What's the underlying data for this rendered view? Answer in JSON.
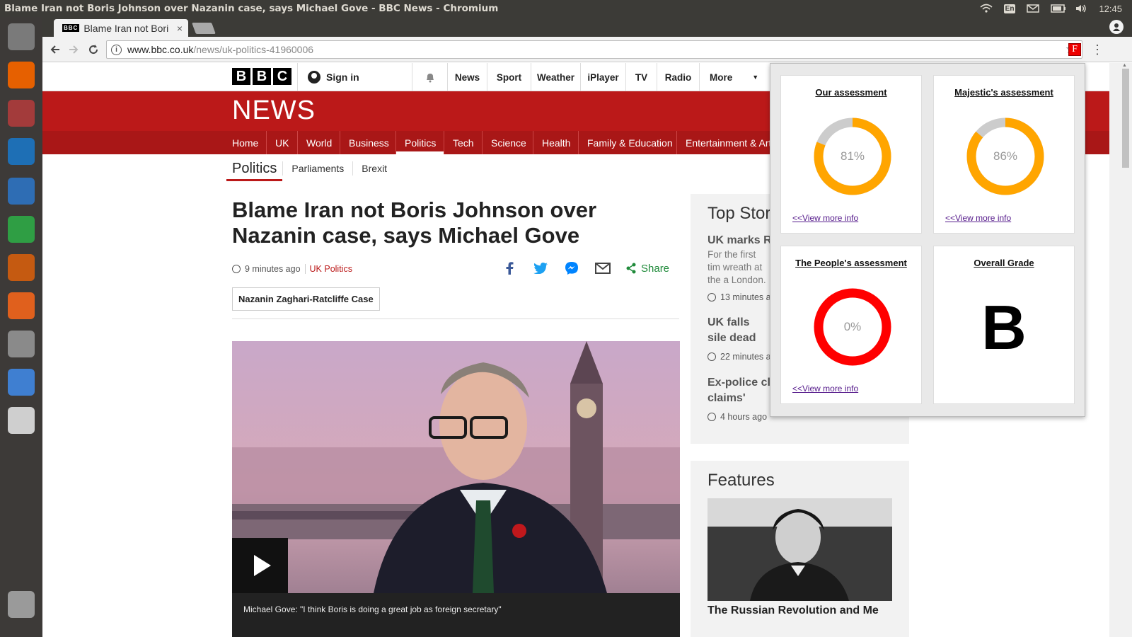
{
  "os": {
    "window_title": "Blame Iran not Boris Johnson over Nazanin case, says Michael Gove - BBC News - Chromium",
    "keyboard_layout": "En",
    "clock": "12:45",
    "tray_icons": [
      "wifi-icon",
      "keyboard-icon",
      "mail-icon",
      "battery-icon",
      "volume-icon"
    ]
  },
  "launcher": {
    "items": [
      {
        "name": "ubuntu-dash-icon",
        "color": "#7a7a7a"
      },
      {
        "name": "firefox-icon",
        "color": "#e66000"
      },
      {
        "name": "files-icon",
        "color": "#a33b3b"
      },
      {
        "name": "remote-desktop-icon",
        "color": "#1e6fb5"
      },
      {
        "name": "libreoffice-writer-icon",
        "color": "#2e6db4"
      },
      {
        "name": "libreoffice-calc-icon",
        "color": "#2f9e44"
      },
      {
        "name": "libreoffice-impress-icon",
        "color": "#c55a11"
      },
      {
        "name": "software-center-icon",
        "color": "#e0601d"
      },
      {
        "name": "system-settings-icon",
        "color": "#8a8a8a"
      },
      {
        "name": "chromium-icon",
        "color": "#3f7fd1"
      },
      {
        "name": "text-editor-icon",
        "color": "#cfcfcf"
      },
      {
        "name": "trash-icon",
        "color": "#9a9a9a"
      }
    ]
  },
  "browser": {
    "tab_favicon": "BBC",
    "tab_title": "Blame Iran not Bori",
    "tab_close": "×",
    "url_host": "www.bbc.co.uk",
    "url_path": "/news/uk-politics-41960006",
    "extension_badge": "F"
  },
  "bbc": {
    "logo": [
      "B",
      "B",
      "C"
    ],
    "sign_in": "Sign in",
    "global_nav": [
      "News",
      "Sport",
      "Weather",
      "iPlayer",
      "TV",
      "Radio",
      "More"
    ],
    "news_word": "NEWS",
    "section_nav": [
      "Home",
      "UK",
      "World",
      "Business",
      "Politics",
      "Tech",
      "Science",
      "Health",
      "Family & Education",
      "Entertainment & Arts"
    ],
    "active_section": "Politics",
    "sub_nav": [
      "Politics",
      "Parliaments",
      "Brexit"
    ]
  },
  "article": {
    "headline": "Blame Iran not Boris Johnson over Nazanin case, says Michael Gove",
    "time": "9 minutes ago",
    "category": "UK Politics",
    "share_label": "Share",
    "tag": "Nazanin Zaghari-Ratcliffe Case",
    "video_caption": "Michael Gove: \"I think Boris is doing a great job as foreign secretary\""
  },
  "top_stories": {
    "title": "Top Stor",
    "items": [
      {
        "title": "UK marks R",
        "summary": "For the first tim wreath at the a London.",
        "time": "13 minutes a"
      },
      {
        "title": "UK falls sile dead",
        "summary": "",
        "time": "22 minutes a"
      },
      {
        "title": "Ex-police cl claims'",
        "summary": "",
        "time": "4 hours ago"
      }
    ]
  },
  "features": {
    "title": "Features",
    "item_title": "The Russian Revolution and Me"
  },
  "popup": {
    "cards": [
      {
        "title": "Our assessment",
        "percent": 81,
        "label": "81%",
        "link": "<<View more info",
        "color": "#ffa500"
      },
      {
        "title": "Majestic's assessment",
        "percent": 86,
        "label": "86%",
        "link": "<<View more info",
        "color": "#ffa500"
      },
      {
        "title": "The People's assessment",
        "percent": 0,
        "label": "0%",
        "link": "<<View more info",
        "color": "#ff0000"
      }
    ],
    "grade_title": "Overall Grade",
    "grade": "B"
  },
  "colors": {
    "bbc_red": "#bb1919",
    "ring_track": "#cccccc",
    "share_green": "#1f8a3a",
    "facebook": "#3b5998",
    "twitter": "#1da1f2",
    "messenger": "#0084ff"
  }
}
